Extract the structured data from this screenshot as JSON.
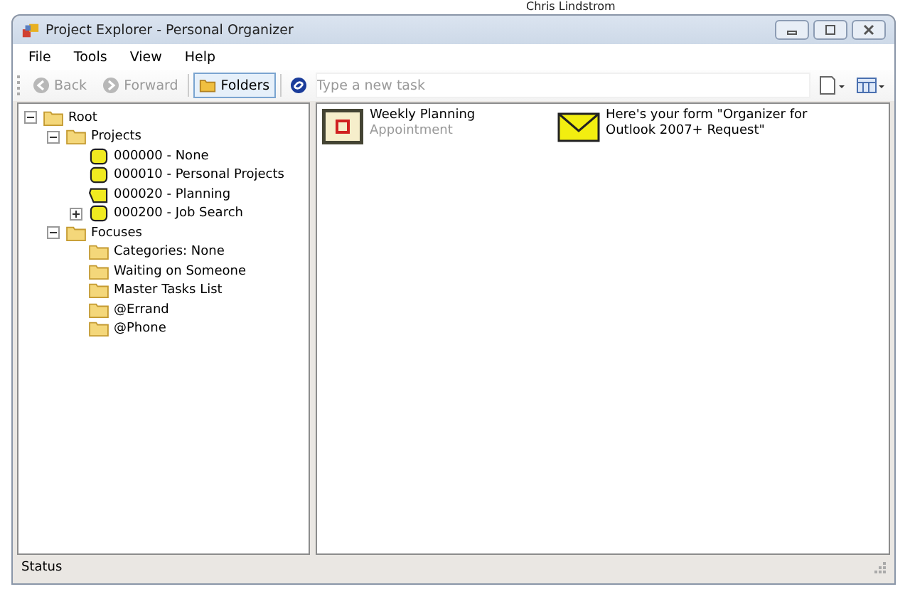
{
  "background_text": "Chris Lindstrom",
  "window": {
    "title": "Project Explorer - Personal Organizer"
  },
  "menu": [
    "File",
    "Tools",
    "View",
    "Help"
  ],
  "toolbar": {
    "back": {
      "label": "Back",
      "disabled": true
    },
    "forward": {
      "label": "Forward",
      "disabled": true
    },
    "folders": {
      "label": "Folders",
      "selected": true
    },
    "task_field": {
      "placeholder": "Type a new task"
    }
  },
  "tree": [
    {
      "label": "Root",
      "kind": "folder",
      "expanded": true,
      "children": [
        {
          "label": "Projects",
          "kind": "folder",
          "expanded": true,
          "children": [
            {
              "label": "000000 - None",
              "kind": "project"
            },
            {
              "label": "000010 - Personal Projects",
              "kind": "project"
            },
            {
              "label": "000020 - Planning",
              "kind": "project-open"
            },
            {
              "label": "000200 - Job Search",
              "kind": "project",
              "expanded": false
            }
          ]
        },
        {
          "label": "Focuses",
          "kind": "folder",
          "expanded": true,
          "children": [
            {
              "label": "Categories: None",
              "kind": "folder"
            },
            {
              "label": "Waiting on Someone",
              "kind": "folder"
            },
            {
              "label": "Master Tasks List",
              "kind": "folder"
            },
            {
              "label": "@Errand",
              "kind": "folder"
            },
            {
              "label": "@Phone",
              "kind": "folder"
            }
          ]
        }
      ]
    }
  ],
  "items": [
    {
      "kind": "appointment",
      "title": "Weekly Planning",
      "subtitle": "Appointment"
    },
    {
      "kind": "mail",
      "title": "Here's your form \"Organizer for Outlook 2007+ Request\""
    }
  ],
  "status_bar": "Status"
}
